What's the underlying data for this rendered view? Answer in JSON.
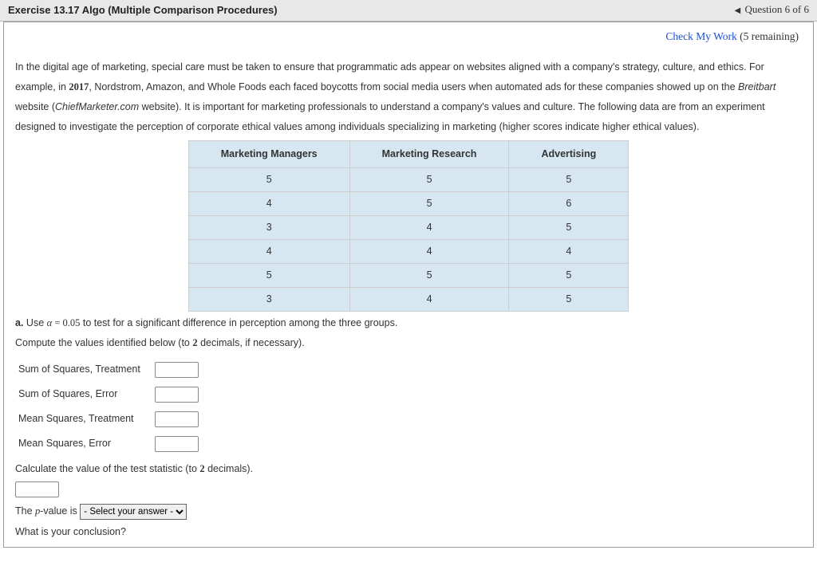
{
  "header": {
    "title": "Exercise 13.17 Algo (Multiple Comparison Procedures)",
    "nav_text": "Question 6 of 6"
  },
  "check": {
    "link": "Check My Work",
    "remaining": "(5 remaining)"
  },
  "paragraph": {
    "p1a": "In the digital age of marketing, special care must be taken to ensure that programmatic ads appear on websites aligned with a company's strategy, culture, and ethics. For example, in ",
    "year": "2017",
    "p1b": ", Nordstrom, Amazon, and Whole Foods each faced boycotts from social media users when automated ads for these companies showed up on the ",
    "breitbart": "Breitbart",
    "p1c": " website (",
    "chief": "ChiefMarketer.com",
    "p1d": " website). It is important for marketing professionals to understand a company's values and culture. The following data are from an experiment designed to investigate the perception of corporate ethical values among individuals specializing in marketing (higher scores indicate higher ethical values)."
  },
  "table": {
    "headers": [
      "Marketing Managers",
      "Marketing Research",
      "Advertising"
    ],
    "rows": [
      [
        "5",
        "5",
        "5"
      ],
      [
        "4",
        "5",
        "6"
      ],
      [
        "3",
        "4",
        "5"
      ],
      [
        "4",
        "4",
        "4"
      ],
      [
        "5",
        "5",
        "5"
      ],
      [
        "3",
        "4",
        "5"
      ]
    ]
  },
  "qa": {
    "label": "a.",
    "text1": " Use ",
    "alpha": "α = 0.05",
    "text2": " to test for a significant difference in perception among the three groups.",
    "compute_a": "Compute the values identified below (to ",
    "two": "2",
    "compute_b": " decimals, if necessary)."
  },
  "inputs": {
    "ss_treatment": "Sum of Squares, Treatment",
    "ss_error": "Sum of Squares, Error",
    "ms_treatment": "Mean Squares, Treatment",
    "ms_error": "Mean Squares, Error"
  },
  "calc": {
    "line_a": "Calculate the value of the test statistic (to ",
    "two": "2",
    "line_b": " decimals).",
    "pvalue_a": "The ",
    "pvalue_p": "p",
    "pvalue_b": "-value is ",
    "select_placeholder": "- Select your answer -",
    "conclusion": "What is your conclusion?"
  }
}
